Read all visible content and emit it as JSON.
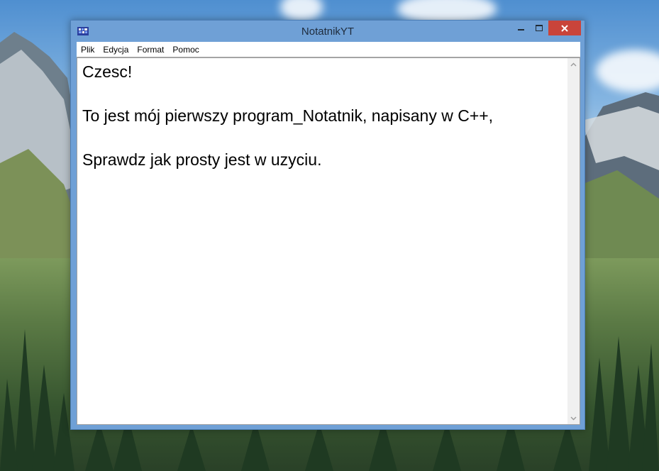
{
  "window": {
    "title": "NotatnikYT"
  },
  "menu": {
    "items": [
      "Plik",
      "Edycja",
      "Format",
      "Pomoc"
    ]
  },
  "editor": {
    "content": "Czesc!\n\nTo jest mój pierwszy program_Notatnik, napisany w C++,\n\nSprawdz jak prosty jest w uzyciu."
  },
  "icons": {
    "app": "notepad-app-icon",
    "minimize": "minimize-icon",
    "maximize": "maximize-icon",
    "close": "close-icon",
    "scroll_up": "chevron-up-icon",
    "scroll_down": "chevron-down-icon"
  },
  "colors": {
    "window_frame": "#6fa0d6",
    "close_button": "#c9443a",
    "editor_background": "#ffffff"
  }
}
